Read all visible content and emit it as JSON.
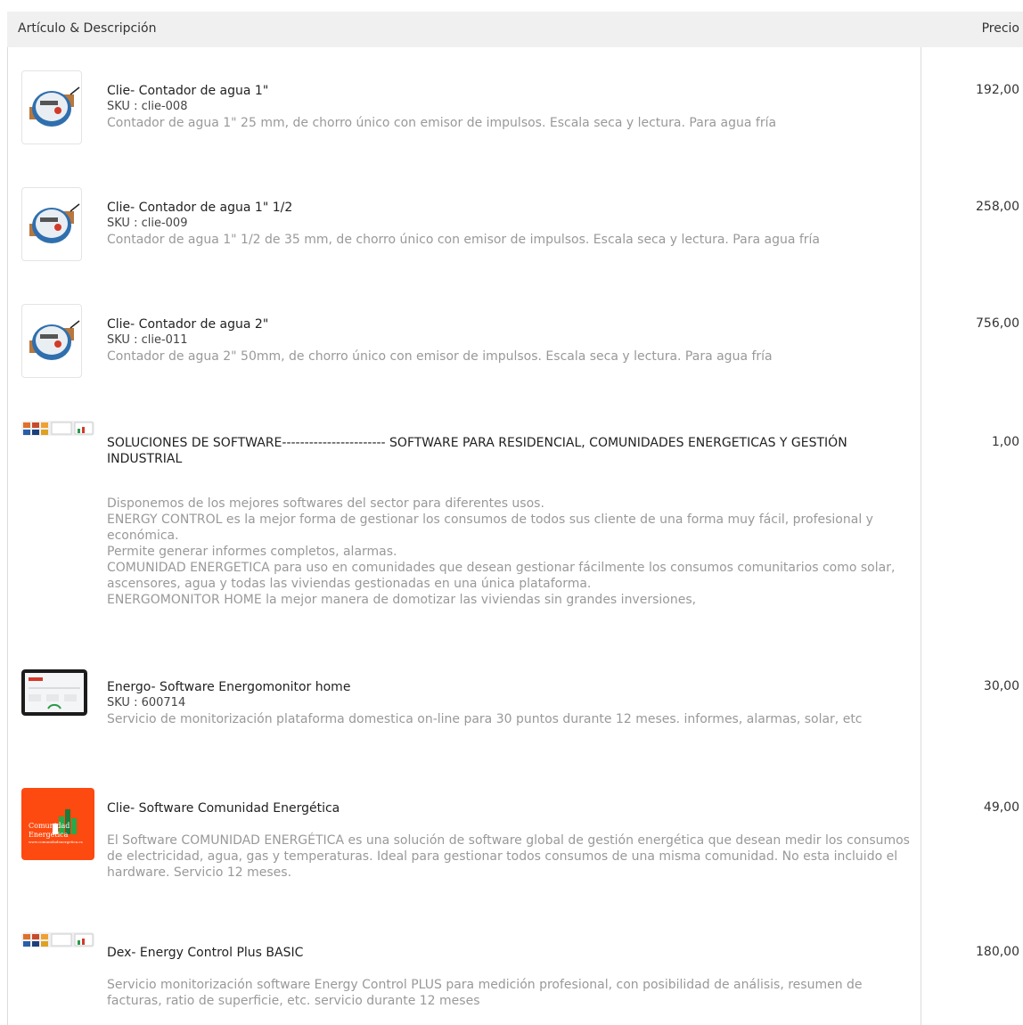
{
  "header": {
    "item_label": "Artículo & Descripción",
    "price_label": "Precio"
  },
  "colors": {
    "header_bg": "#f0f0f0",
    "text": "#333333",
    "muted": "#999999",
    "brand_orange": "#fd4a10"
  },
  "rows": [
    {
      "image": "water-meter",
      "name": "Clie- Contador de agua 1\"",
      "sku": "SKU : clie-008",
      "desc": "Contador de agua  1\"  25 mm, de chorro único con emisor de impulsos. Escala seca y lectura. Para agua fría",
      "price": "192,00"
    },
    {
      "image": "water-meter",
      "name": "Clie- Contador de agua 1\" 1/2",
      "sku": "SKU : clie-009",
      "desc": "Contador de agua  1\" 1/2 de 35 mm, de chorro único con emisor de impulsos. Escala seca y lectura. Para agua fría",
      "price": "258,00"
    },
    {
      "image": "water-meter",
      "name": "Clie- Contador de agua 2\"",
      "sku": "SKU : clie-011",
      "desc": "Contador de agua  2\"   50mm, de chorro único con emisor de impulsos. Escala seca y lectura. Para agua fría",
      "price": "756,00"
    },
    {
      "image": "software-dashboards",
      "name": "SOLUCIONES DE SOFTWARE----------------------- SOFTWARE PARA RESIDENCIAL, COMUNIDADES ENERGETICAS Y GESTIÓN INDUSTRIAL",
      "desc_lines": [
        "Disponemos de los mejores softwares del sector para diferentes usos.",
        "ENERGY CONTROL es la mejor forma de gestionar los consumos de todos sus cliente de una forma muy fácil, profesional y económica.",
        "Permite generar informes completos, alarmas.",
        "COMUNIDAD ENERGETICA para uso en comunidades que desean gestionar fácilmente los consumos comunitarios como solar, ascensores, agua y todas las viviendas gestionadas en una única plataforma.",
        "ENERGOMONITOR HOME la mejor manera de domotizar las viviendas sin grandes inversiones,"
      ],
      "price": "1,00"
    },
    {
      "image": "tablet-dashboard",
      "name": "Energo- Software Energomonitor home",
      "sku": "SKU : 600714",
      "desc": "Servicio de monitorización plataforma domestica on-line para 30 puntos durante 12 meses. informes, alarmas, solar, etc",
      "price": "30,00"
    },
    {
      "image": "comunidad-energetica-logo",
      "logo_text": [
        "Comunidad",
        "Energética",
        "www.comunidadenergetica.es"
      ],
      "name": "Clie- Software Comunidad Energética",
      "desc": "El Software COMUNIDAD ENERGÉTICA es una solución de software global de gestión energética que desean medir los consumos de electricidad, agua, gas y temperaturas. Ideal para gestionar todos consumos de una misma comunidad. No esta incluido el hardware. Servicio 12 meses.",
      "price": "49,00"
    },
    {
      "image": "software-dashboards",
      "name": "Dex- Energy Control Plus BASIC",
      "desc": "Servicio monitorización software Energy Control PLUS para medición profesional, con posibilidad de análisis, resumen de facturas, ratio de superficie, etc. servicio durante 12 meses",
      "price": "180,00"
    }
  ]
}
